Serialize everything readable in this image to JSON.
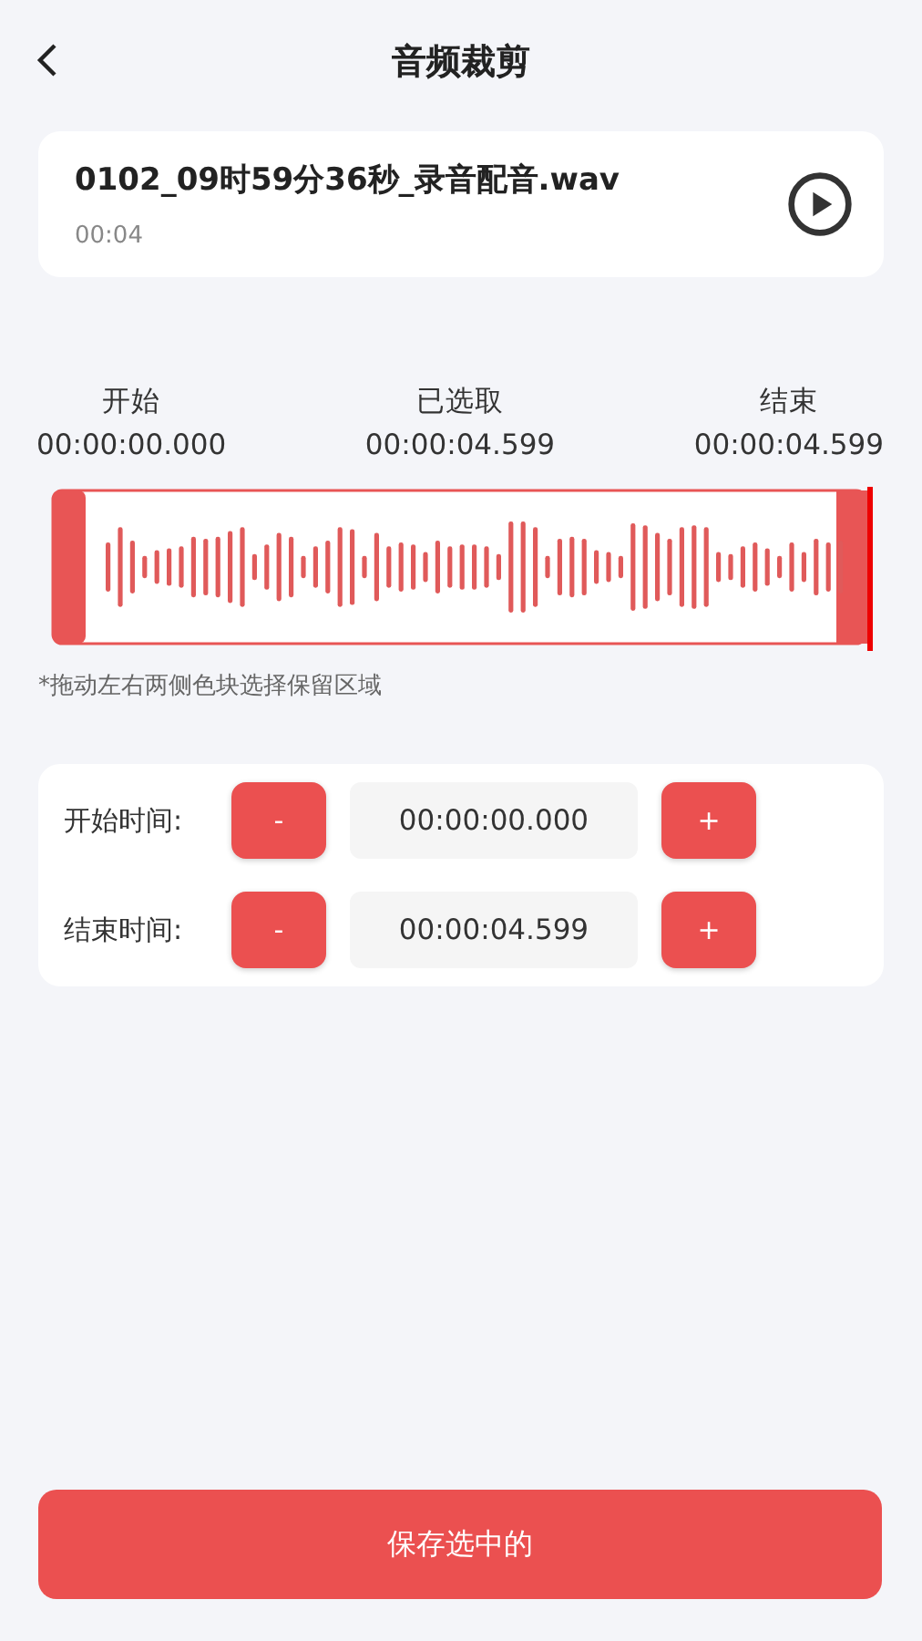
{
  "header": {
    "title": "音频裁剪"
  },
  "file": {
    "name": "0102_09时59分36秒_录音配音.wav",
    "duration": "00:04"
  },
  "times": [
    {
      "label": "开始",
      "value": "00:00:00.000"
    },
    {
      "label": "已选取",
      "value": "00:00:04.599"
    },
    {
      "label": "结束",
      "value": "00:00:04.599"
    }
  ],
  "waveform": {
    "hint": "*拖动左右两侧色块选择保留区域"
  },
  "controls": [
    {
      "label": "开始时间:",
      "minus": "-",
      "value": "00:00:00.000",
      "plus": "+"
    },
    {
      "label": "结束时间:",
      "minus": "-",
      "value": "00:00:04.599",
      "plus": "+"
    }
  ],
  "save_button": "保存选中的"
}
